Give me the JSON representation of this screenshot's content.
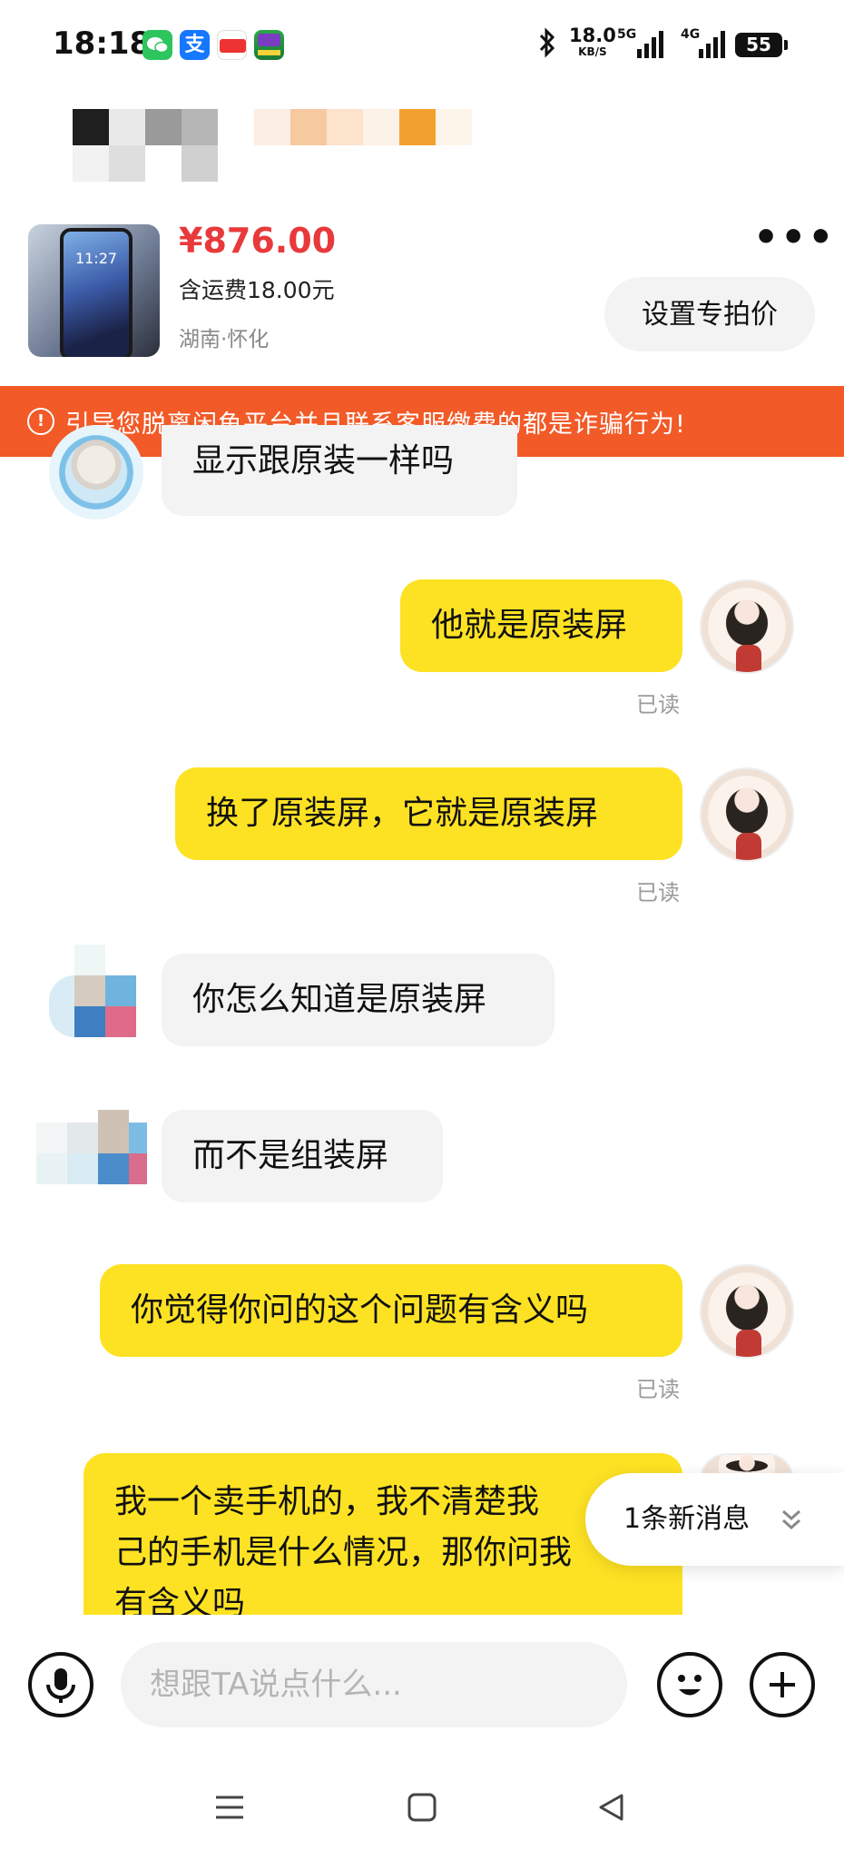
{
  "status_bar": {
    "time": "18:18",
    "net_speed": "18.0",
    "net_unit": "KB/S",
    "signal_1": "5G",
    "signal_2": "4G",
    "battery": "55"
  },
  "product": {
    "price": "¥876.00",
    "shipping": "含运费18.00元",
    "location": "湖南·怀化",
    "thumb_time": "11:27",
    "special_price_button": "设置专拍价"
  },
  "warning": {
    "icon": "!",
    "text": "引导您脱离闲鱼平台并且联系客服缴费的都是诈骗行为!"
  },
  "messages": [
    {
      "from": "seller",
      "text": "显示跟原装一样吗"
    },
    {
      "from": "me",
      "text": "他就是原装屏",
      "status": "已读"
    },
    {
      "from": "me",
      "text": "换了原装屏，它就是原装屏",
      "status": "已读"
    },
    {
      "from": "seller",
      "text": "你怎么知道是原装屏"
    },
    {
      "from": "seller",
      "text": "而不是组装屏"
    },
    {
      "from": "me",
      "text": "你觉得你问的这个问题有含义吗",
      "status": "已读"
    },
    {
      "from": "me",
      "text": "我一个卖手机的，我不清楚我自己的手机是什么情况，那你问我有含义吗"
    }
  ],
  "long_message_lines": [
    "我一个卖手机的，我不清楚我",
    "己的手机是什么情况，那你问我",
    "有含义吗"
  ],
  "new_message_banner": "1条新消息",
  "input": {
    "placeholder": "想跟TA说点什么..."
  },
  "icons": {
    "mic": "mic-icon",
    "emoji": "emoji-icon",
    "plus": "plus-icon",
    "more": "more-icon"
  },
  "colors": {
    "warning_bg": "#f25a27",
    "my_bubble": "#fde223",
    "their_bubble": "#f3f3f4",
    "price": "#e8393b"
  }
}
